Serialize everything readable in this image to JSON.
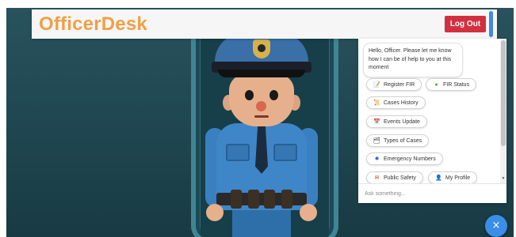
{
  "header": {
    "brand": "OfficerDesk",
    "logout_label": "Log Out"
  },
  "chat": {
    "greeting": "Hello, Officer. Please let me know how I can be of help to you at this moment",
    "quick_replies": [
      {
        "label": "Register FIR",
        "icon": "document-icon"
      },
      {
        "label": "FIR Status",
        "icon": "status-icon"
      },
      {
        "label": "Cases History",
        "icon": "history-icon"
      },
      {
        "label": "Events Update",
        "icon": "calendar-icon"
      },
      {
        "label": "Types of Cases",
        "icon": "folder-icon"
      },
      {
        "label": "Emergency Numbers",
        "icon": "siren-icon"
      },
      {
        "label": "Public Safety",
        "icon": "envelope-icon"
      },
      {
        "label": "My Profile",
        "icon": "person-icon"
      }
    ],
    "input_placeholder": "Ask something..."
  },
  "fab": {
    "icon": "close-icon",
    "glyph": "×"
  },
  "colors": {
    "brand": "#f0a045",
    "logout": "#d3303f",
    "fab": "#3a8ee8",
    "backdrop": "#234b55"
  }
}
